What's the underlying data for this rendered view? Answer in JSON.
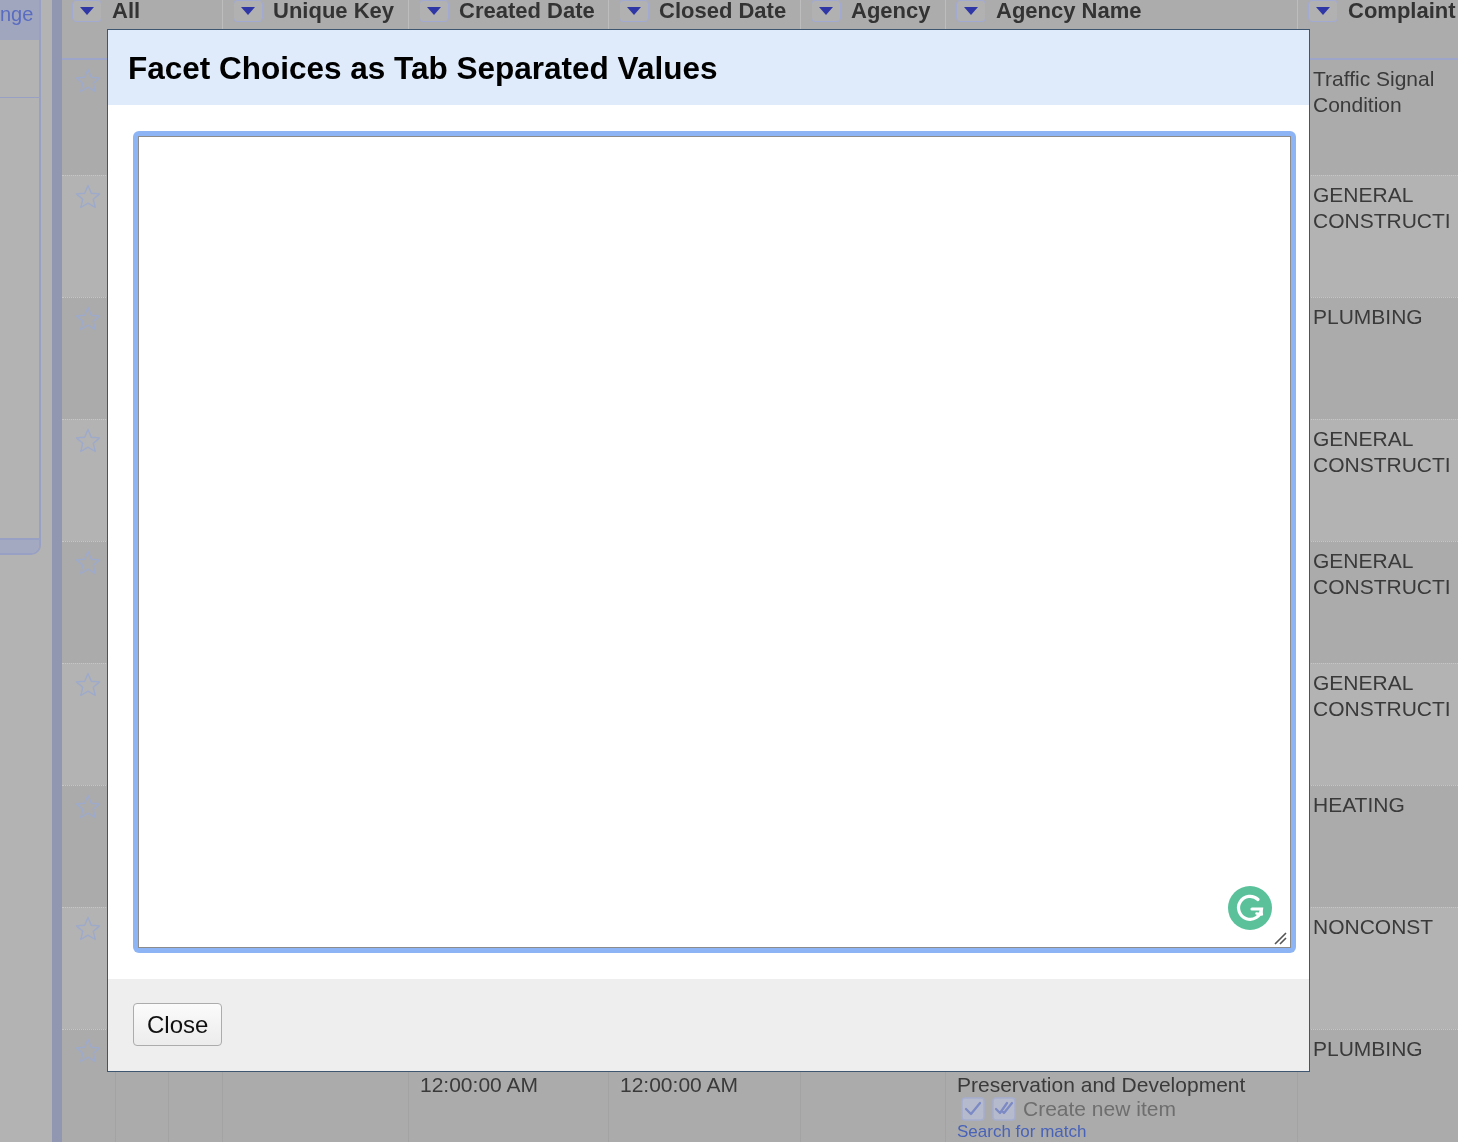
{
  "side_panel": {
    "tab": "nge"
  },
  "table": {
    "columns": [
      "All",
      "Unique Key",
      "Created Date",
      "Closed Date",
      "Agency",
      "Agency Name",
      "Complaint"
    ],
    "rows": [
      {
        "starred": false,
        "complaint": "Traffic Signal Condition"
      },
      {
        "starred": false,
        "complaint": "GENERAL CONSTRUCTI"
      },
      {
        "starred": false,
        "complaint": "PLUMBING"
      },
      {
        "starred": false,
        "complaint": "GENERAL CONSTRUCTI"
      },
      {
        "starred": false,
        "complaint": "GENERAL CONSTRUCTI"
      },
      {
        "starred": false,
        "complaint": "GENERAL CONSTRUCTI"
      },
      {
        "starred": false,
        "complaint": "HEATING"
      },
      {
        "starred": false,
        "complaint": "NONCONST"
      },
      {
        "starred": false,
        "created_date": "12:00:00 AM",
        "closed_date": "12:00:00 AM",
        "agency_name": "Preservation and Development",
        "reconcile": {
          "create_label": "Create new item",
          "search_label": "Search for match"
        },
        "complaint": "PLUMBING"
      }
    ]
  },
  "dialog": {
    "title": "Facet Choices as Tab Separated Values",
    "textarea": {
      "focused": true
    },
    "close_button": "Close"
  }
}
